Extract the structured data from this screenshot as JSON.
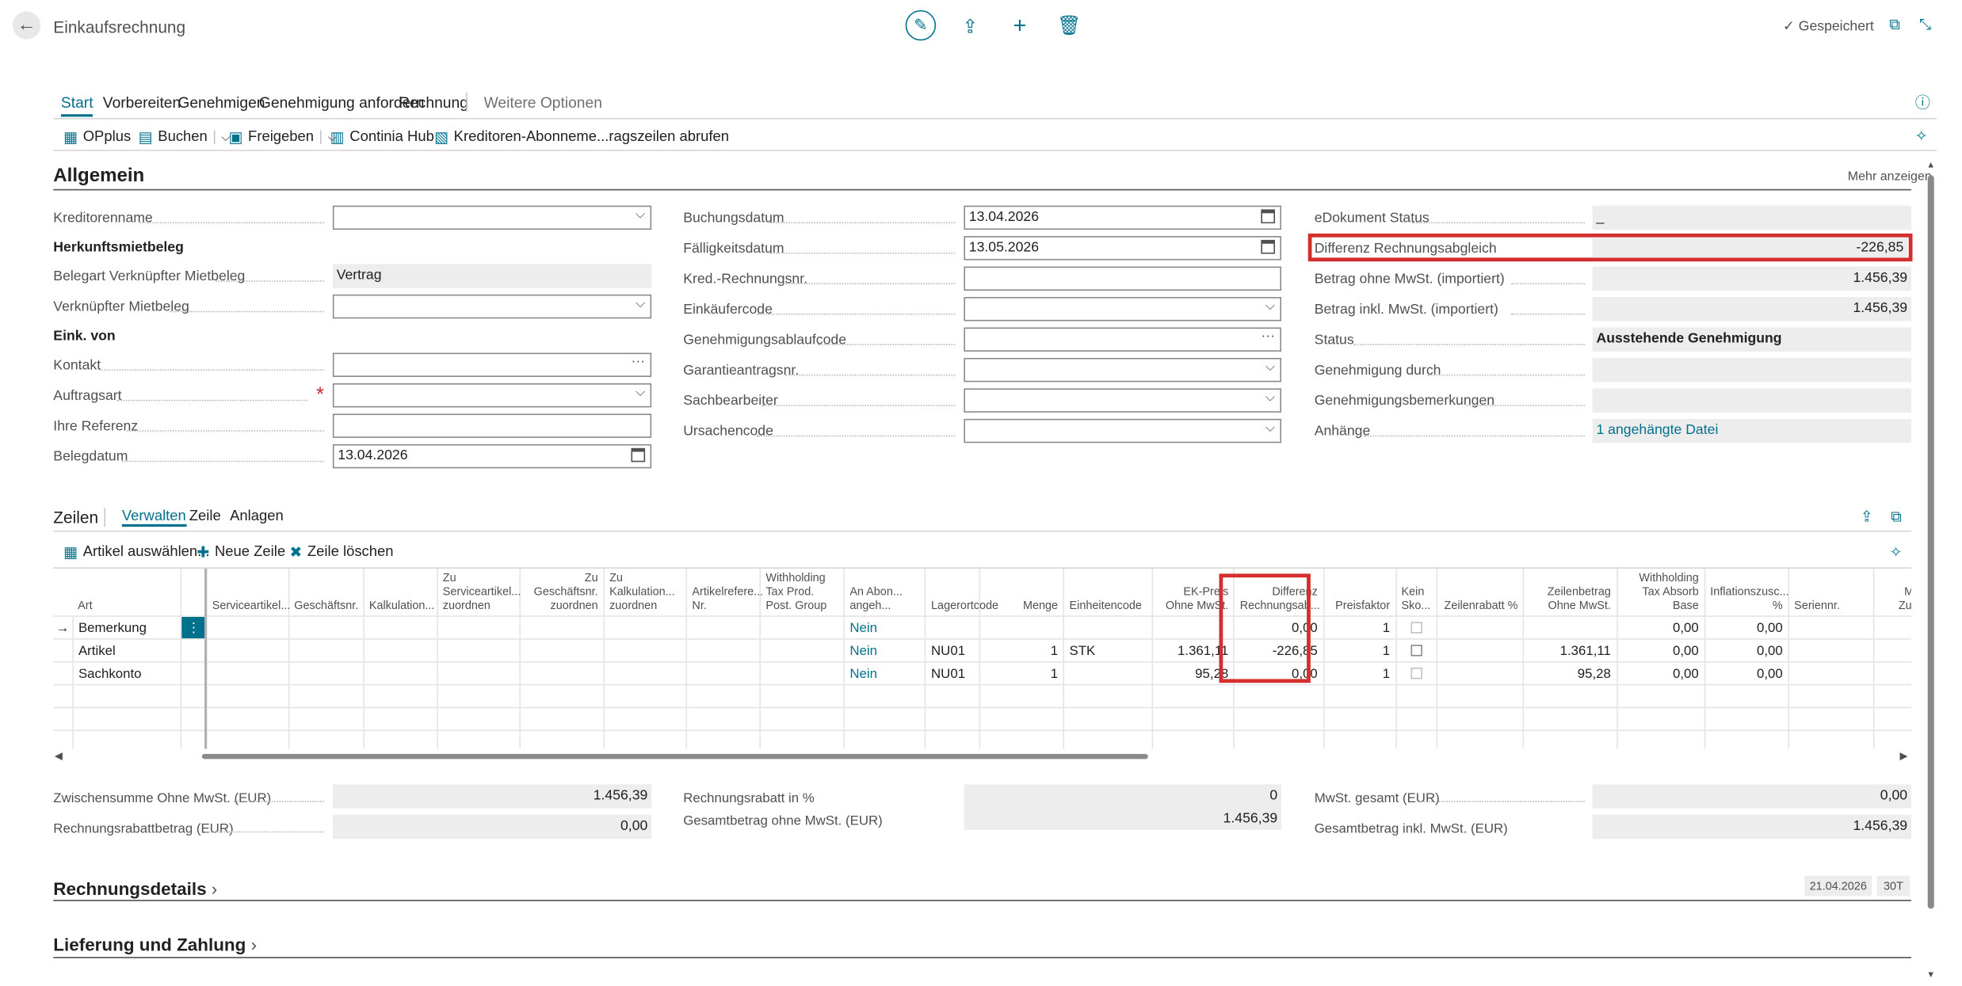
{
  "header": {
    "title": "Einkaufsrechnung",
    "saved_label": "Gespeichert"
  },
  "menu": {
    "items": [
      "Start",
      "Vorbereiten",
      "Genehmigen",
      "Genehmigung anfordern",
      "Rechnung"
    ],
    "more": "Weitere Optionen"
  },
  "actions": {
    "opplus": "OPplus",
    "buchen": "Buchen",
    "freigeben": "Freigeben",
    "continia": "Continia Hub",
    "kreditoren": "Kreditoren-Abonneme...ragszeilen abrufen"
  },
  "allgemein": {
    "title": "Allgemein",
    "more": "Mehr anzeigen",
    "col1": {
      "kreditorenname": {
        "label": "Kreditorenname",
        "value": ""
      },
      "herkunft_heading": "Herkunftsmietbeleg",
      "belegart": {
        "label": "Belegart Verknüpfter Mietbeleg",
        "value": "Vertrag"
      },
      "verknuepfter": {
        "label": "Verknüpfter Mietbeleg",
        "value": ""
      },
      "eink_heading": "Eink. von",
      "kontakt": {
        "label": "Kontakt",
        "value": ""
      },
      "auftragsart": {
        "label": "Auftragsart",
        "value": ""
      },
      "referenz": {
        "label": "Ihre Referenz",
        "value": ""
      },
      "belegdatum": {
        "label": "Belegdatum",
        "value": "13.04.2026"
      }
    },
    "col2": {
      "buchungsdatum": {
        "label": "Buchungsdatum",
        "value": "13.04.2026"
      },
      "faelligkeit": {
        "label": "Fälligkeitsdatum",
        "value": "13.05.2026"
      },
      "kred_nr": {
        "label": "Kred.-Rechnungsnr.",
        "value": ""
      },
      "einkaeufer": {
        "label": "Einkäufercode",
        "value": ""
      },
      "genehmigung": {
        "label": "Genehmigungsablaufcode",
        "value": ""
      },
      "garantie": {
        "label": "Garantieantragsnr.",
        "value": ""
      },
      "sachbearbeiter": {
        "label": "Sachbearbeiter",
        "value": ""
      },
      "ursachen": {
        "label": "Ursachencode",
        "value": ""
      }
    },
    "col3": {
      "edokument": {
        "label": "eDokument Status",
        "value": "_"
      },
      "differenz": {
        "label": "Differenz Rechnungsabgleich",
        "value": "-226,85"
      },
      "ohne_mwst": {
        "label": "Betrag ohne MwSt. (importiert)",
        "value": "1.456,39"
      },
      "inkl_mwst": {
        "label": "Betrag inkl. MwSt. (importiert)",
        "value": "1.456,39"
      },
      "status": {
        "label": "Status",
        "value": "Ausstehende Genehmigung"
      },
      "genehmigung_durch": {
        "label": "Genehmigung durch",
        "value": ""
      },
      "bemerkungen": {
        "label": "Genehmigungsbemerkungen",
        "value": ""
      },
      "anhaenge": {
        "label": "Anhänge",
        "value": "1 angehängte Datei"
      }
    }
  },
  "lines": {
    "title": "Zeilen",
    "tabs": [
      "Verwalten",
      "Zeile",
      "Anlagen"
    ],
    "actions": {
      "artikel": "Artikel auswählen...",
      "neue": "Neue Zeile",
      "loeschen": "Zeile löschen"
    },
    "columns": [
      "Art",
      "Serviceartikel...",
      "Geschäftsnr.",
      "Kalkulation...",
      "Zu Serviceartikel... zuordnen",
      "Zu Geschäftsnr. zuordnen",
      "Zu Kalkulation... zuordnen",
      "Artikelrefere... Nr.",
      "Withholding Tax Prod. Post. Group",
      "An Abon... angeh...",
      "Lagerortcode",
      "Menge",
      "Einheitencode",
      "EK-Preis Ohne MwSt.",
      "Differenz Rechnungsab...",
      "Preisfaktor",
      "Kein Sko...",
      "Zeilenrabatt %",
      "Zeilenbetrag Ohne MwSt.",
      "Withholding Tax Absorb Base",
      "Inflationszusc... %",
      "Seriennr.",
      "Men Zuwe"
    ],
    "rows": [
      {
        "art": "Bemerkung",
        "an_abon": "Nein",
        "lager": "",
        "menge": "",
        "einheit": "",
        "ek_preis": "",
        "differenz": "0,00",
        "preisfaktor": "1",
        "zeilenbetrag": "",
        "absorb": "0,00",
        "inflation": "0,00"
      },
      {
        "art": "Artikel",
        "an_abon": "Nein",
        "lager": "NU01",
        "menge": "1",
        "einheit": "STK",
        "ek_preis": "1.361,11",
        "differenz": "-226,85",
        "preisfaktor": "1",
        "zeilenbetrag": "1.361,11",
        "absorb": "0,00",
        "inflation": "0,00"
      },
      {
        "art": "Sachkonto",
        "an_abon": "Nein",
        "lager": "NU01",
        "menge": "1",
        "einheit": "",
        "ek_preis": "95,28",
        "differenz": "0,00",
        "preisfaktor": "1",
        "zeilenbetrag": "95,28",
        "absorb": "0,00",
        "inflation": "0,00"
      }
    ]
  },
  "totals": {
    "zwischensumme": {
      "label": "Zwischensumme Ohne MwSt. (EUR)",
      "value": "1.456,39"
    },
    "rabattbetrag": {
      "label": "Rechnungsrabattbetrag (EUR)",
      "value": "0,00"
    },
    "rabatt_pct": {
      "label": "Rechnungsrabatt in %",
      "value": "0"
    },
    "gesamt_ohne": {
      "label": "Gesamtbetrag ohne MwSt. (EUR)",
      "value": "1.456,39"
    },
    "mwst_gesamt": {
      "label": "MwSt. gesamt (EUR)",
      "value": "0,00"
    },
    "gesamt_inkl": {
      "label": "Gesamtbetrag inkl. MwSt. (EUR)",
      "value": "1.456,39"
    }
  },
  "collapsed": {
    "rechnungsdetails": "Rechnungsdetails",
    "lieferung": "Lieferung und Zahlung",
    "date_pill": "21.04.2026",
    "term_pill": "30T"
  },
  "colors": {
    "accent": "#00718d",
    "highlight": "#d32f2f"
  }
}
